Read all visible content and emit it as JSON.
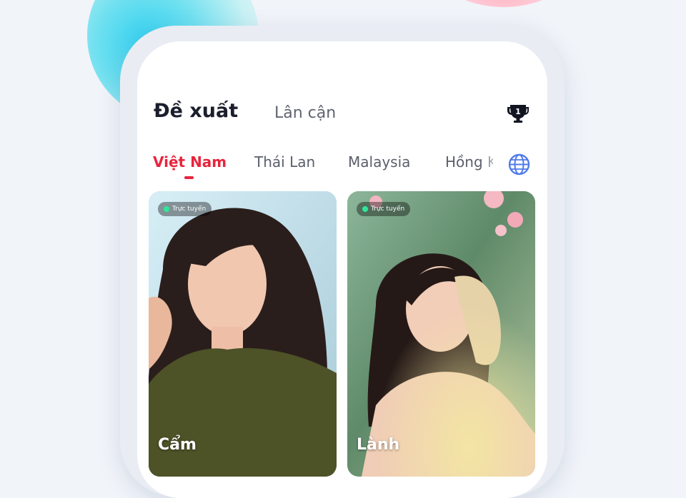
{
  "header": {
    "tabs": [
      {
        "label": "Đề xuất",
        "active": true
      },
      {
        "label": "Lân cận",
        "active": false
      }
    ],
    "leaderboard_icon": "trophy-icon",
    "leaderboard_rank": "1"
  },
  "regions": {
    "items": [
      {
        "label": "Việt Nam",
        "active": true
      },
      {
        "label": "Thái Lan",
        "active": false
      },
      {
        "label": "Malaysia",
        "active": false
      },
      {
        "label": "Hồng K",
        "active": false
      }
    ],
    "globe_icon": "globe-icon"
  },
  "cards": [
    {
      "name": "Cẩm",
      "status": "Trực tuyến"
    },
    {
      "name": "Lành",
      "status": "Trực tuyến"
    }
  ],
  "colors": {
    "accent": "#e8253e",
    "online": "#2ee89a",
    "globe": "#4f7bea"
  }
}
